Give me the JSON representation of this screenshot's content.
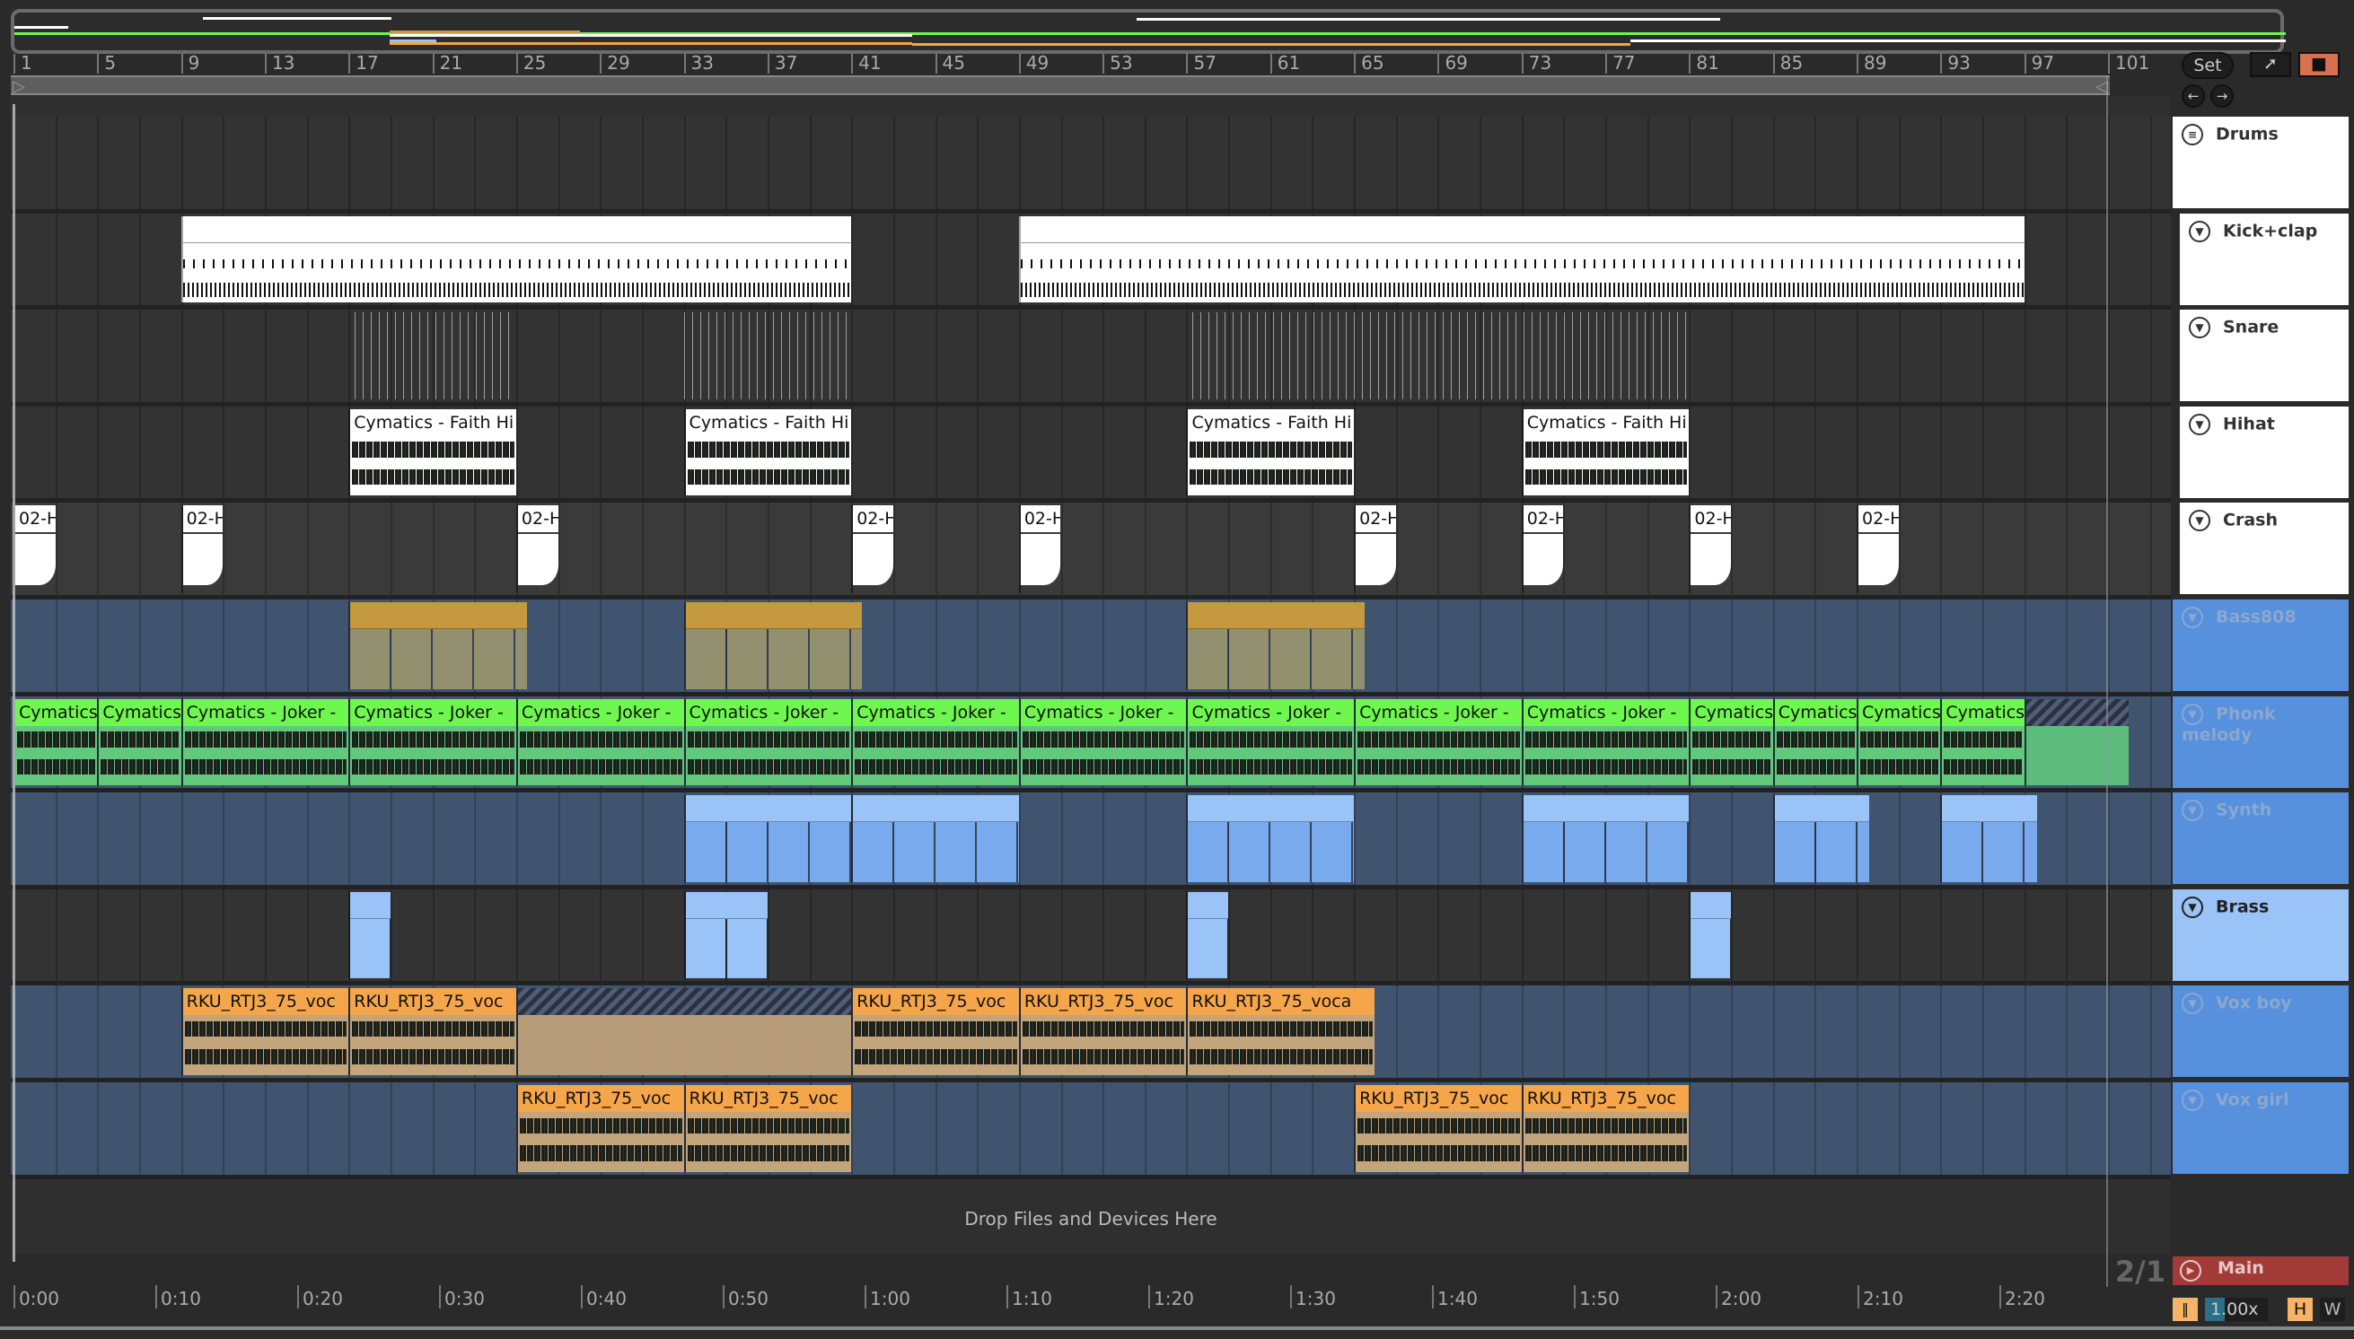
{
  "ruler": {
    "bars": [
      1,
      5,
      9,
      13,
      17,
      21,
      25,
      29,
      33,
      37,
      41,
      45,
      49,
      53,
      57,
      61,
      65,
      69,
      73,
      77,
      81,
      85,
      89,
      93,
      97,
      101
    ]
  },
  "time_ruler": [
    "0:00",
    "0:10",
    "0:20",
    "0:30",
    "0:40",
    "0:50",
    "1:00",
    "1:10",
    "1:20",
    "1:30",
    "1:40",
    "1:50",
    "2:00",
    "2:10",
    "2:20"
  ],
  "controls": {
    "set_label": "Set",
    "meter": "2/1",
    "tempo_scale": "1.00x",
    "h_label": "H",
    "w_label": "W"
  },
  "drop_hint": "Drop Files and Devices Here",
  "main_track": {
    "name": "Main",
    "color": "#a23b37"
  },
  "tracks": [
    {
      "name": "Drums",
      "type": "group",
      "lane": "#333333",
      "header": "#ffffff",
      "text": "#333",
      "icon": "group",
      "clips": []
    },
    {
      "name": "Kick+clap",
      "type": "midi",
      "lane": "#333333",
      "header": "#ffffff",
      "text": "#333",
      "clipColor": "#ffffff",
      "clips": [
        {
          "s": 9,
          "e": 41,
          "l": ""
        },
        {
          "s": 49,
          "e": 97,
          "l": ""
        }
      ]
    },
    {
      "name": "Snare",
      "type": "lines",
      "lane": "#333333",
      "header": "#ffffff",
      "text": "#333",
      "clipColor": "#bbbbbb",
      "clips": [
        {
          "s": 17.3,
          "e": 25,
          "l": ""
        },
        {
          "s": 33,
          "e": 41,
          "l": ""
        },
        {
          "s": 57.3,
          "e": 81,
          "l": ""
        }
      ]
    },
    {
      "name": "Hihat",
      "type": "audio",
      "lane": "#333333",
      "header": "#ffffff",
      "text": "#333",
      "clipColor": "#ffffff",
      "body": "#ffffff",
      "clips": [
        {
          "s": 17,
          "e": 25,
          "l": "Cymatics - Faith Hi"
        },
        {
          "s": 33,
          "e": 41,
          "l": "Cymatics - Faith Hi"
        },
        {
          "s": 57,
          "e": 65,
          "l": "Cymatics - Faith Hi"
        },
        {
          "s": 73,
          "e": 81,
          "l": "Cymatics - Faith Hi"
        }
      ]
    },
    {
      "name": "Crash",
      "type": "crash",
      "lane": "#3a3a3a",
      "header": "#ffffff",
      "text": "#333",
      "clipColor": "#ffffff",
      "clips": [
        {
          "s": 1,
          "e": 3,
          "l": "02-H"
        },
        {
          "s": 9,
          "e": 11,
          "l": "02-H"
        },
        {
          "s": 25,
          "e": 27,
          "l": "02-H"
        },
        {
          "s": 41,
          "e": 43,
          "l": "02-H"
        },
        {
          "s": 49,
          "e": 51,
          "l": "02-H"
        },
        {
          "s": 65,
          "e": 67,
          "l": "02-H"
        },
        {
          "s": 73,
          "e": 75,
          "l": "02-H"
        },
        {
          "s": 81,
          "e": 83,
          "l": "02-H"
        },
        {
          "s": 89,
          "e": 91,
          "l": "02-H"
        }
      ]
    },
    {
      "name": "Bass808",
      "type": "midi2",
      "lane": "#41546f",
      "header": "#5790dd",
      "text": "#8aa8d0",
      "clipColor": "#c5993f",
      "body": "#93906f",
      "clips": [
        {
          "s": 17,
          "e": 25.5,
          "l": ""
        },
        {
          "s": 33,
          "e": 41.5,
          "l": ""
        },
        {
          "s": 57,
          "e": 65.5,
          "l": ""
        }
      ]
    },
    {
      "name": "Phonk melody",
      "type": "audio",
      "lane": "#41546f",
      "header": "#5790dd",
      "text": "#8aa8d0",
      "clipColor": "#6ef74f",
      "body": "#61c87c",
      "clips": [
        {
          "s": 1,
          "e": 5,
          "l": "Cymatics"
        },
        {
          "s": 5,
          "e": 9,
          "l": "Cymatics"
        },
        {
          "s": 9,
          "e": 17,
          "l": "Cymatics - Joker -"
        },
        {
          "s": 17,
          "e": 25,
          "l": "Cymatics - Joker -"
        },
        {
          "s": 25,
          "e": 33,
          "l": "Cymatics - Joker -"
        },
        {
          "s": 33,
          "e": 41,
          "l": "Cymatics - Joker -"
        },
        {
          "s": 41,
          "e": 49,
          "l": "Cymatics - Joker -"
        },
        {
          "s": 49,
          "e": 57,
          "l": "Cymatics - Joker -"
        },
        {
          "s": 57,
          "e": 65,
          "l": "Cymatics - Joker -"
        },
        {
          "s": 65,
          "e": 73,
          "l": "Cymatics - Joker -"
        },
        {
          "s": 73,
          "e": 81,
          "l": "Cymatics - Joker -"
        },
        {
          "s": 81,
          "e": 85,
          "l": "Cymatics"
        },
        {
          "s": 85,
          "e": 89,
          "l": "Cymatics"
        },
        {
          "s": 89,
          "e": 93,
          "l": "Cymatics"
        },
        {
          "s": 93,
          "e": 97,
          "l": "Cymatics"
        },
        {
          "s": 97,
          "e": 102,
          "l": "",
          "hatch": true
        }
      ]
    },
    {
      "name": "Synth",
      "type": "midi2",
      "lane": "#41546f",
      "header": "#5790dd",
      "text": "#8aa8d0",
      "clipColor": "#9ac3f7",
      "body": "#79aaee",
      "clips": [
        {
          "s": 33,
          "e": 41,
          "l": ""
        },
        {
          "s": 41,
          "e": 49,
          "l": ""
        },
        {
          "s": 57,
          "e": 65,
          "l": ""
        },
        {
          "s": 73,
          "e": 81,
          "l": ""
        },
        {
          "s": 85,
          "e": 89.6,
          "l": ""
        },
        {
          "s": 93,
          "e": 97.6,
          "l": ""
        }
      ]
    },
    {
      "name": "Brass",
      "type": "midi2",
      "lane": "#333333",
      "header": "#9ac3f7",
      "text": "#222",
      "clipColor": "#9ac3f7",
      "body": "#9ac3f7",
      "clips": [
        {
          "s": 17,
          "e": 19,
          "l": ""
        },
        {
          "s": 33,
          "e": 37,
          "l": ""
        },
        {
          "s": 57,
          "e": 59,
          "l": ""
        },
        {
          "s": 81,
          "e": 83,
          "l": ""
        }
      ]
    },
    {
      "name": "Vox boy",
      "type": "audio",
      "lane": "#41546f",
      "header": "#5790dd",
      "text": "#8aa8d0",
      "clipColor": "#f5a54a",
      "body": "#c4a47a",
      "clips": [
        {
          "s": 9,
          "e": 17,
          "l": "RKU_RTJ3_75_voc"
        },
        {
          "s": 17,
          "e": 25,
          "l": "RKU_RTJ3_75_voc"
        },
        {
          "s": 25,
          "e": 41,
          "l": "",
          "hatch": true
        },
        {
          "s": 41,
          "e": 49,
          "l": "RKU_RTJ3_75_voc"
        },
        {
          "s": 49,
          "e": 57,
          "l": "RKU_RTJ3_75_voc"
        },
        {
          "s": 57,
          "e": 66,
          "l": "RKU_RTJ3_75_voca"
        }
      ]
    },
    {
      "name": "Vox girl",
      "type": "audio",
      "lane": "#41546f",
      "header": "#5790dd",
      "text": "#8aa8d0",
      "clipColor": "#f5a54a",
      "body": "#c4a47a",
      "clips": [
        {
          "s": 25,
          "e": 33,
          "l": "RKU_RTJ3_75_voc"
        },
        {
          "s": 33,
          "e": 41,
          "l": "RKU_RTJ3_75_voc"
        },
        {
          "s": 65,
          "e": 73,
          "l": "RKU_RTJ3_75_voc"
        },
        {
          "s": 73,
          "e": 81,
          "l": "RKU_RTJ3_75_voc"
        }
      ]
    }
  ]
}
